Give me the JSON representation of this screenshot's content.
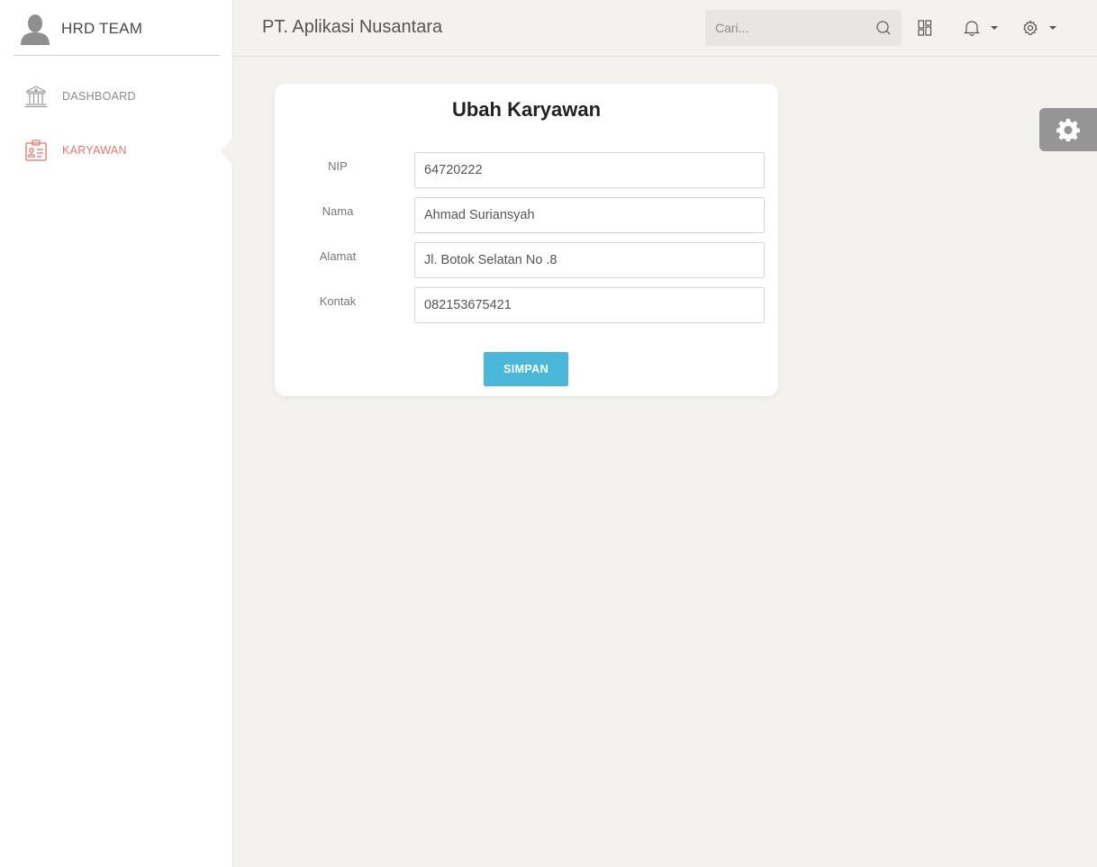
{
  "sidebar": {
    "brand": "HRD TEAM",
    "items": [
      {
        "label": "DASHBOARD",
        "icon": "bank-icon",
        "active": false
      },
      {
        "label": "KARYAWAN",
        "icon": "id-card-icon",
        "active": true
      }
    ]
  },
  "topbar": {
    "company": "PT. Aplikasi Nusantara",
    "search_placeholder": "Cari...",
    "icons": [
      "search-icon",
      "grid-icon",
      "bell-icon",
      "gear-icon"
    ]
  },
  "form": {
    "title": "Ubah Karyawan",
    "fields": [
      {
        "label": "NIP",
        "value": "64720222"
      },
      {
        "label": "Nama",
        "value": "Ahmad Suriansyah"
      },
      {
        "label": "Alamat",
        "value": "Jl. Botok Selatan No .8"
      },
      {
        "label": "Kontak",
        "value": "082153675421"
      }
    ],
    "submit_label": "SIMPAN"
  },
  "colors": {
    "accent": "#e3776a",
    "button": "#4bb8d9",
    "background": "#f3f2ef"
  }
}
